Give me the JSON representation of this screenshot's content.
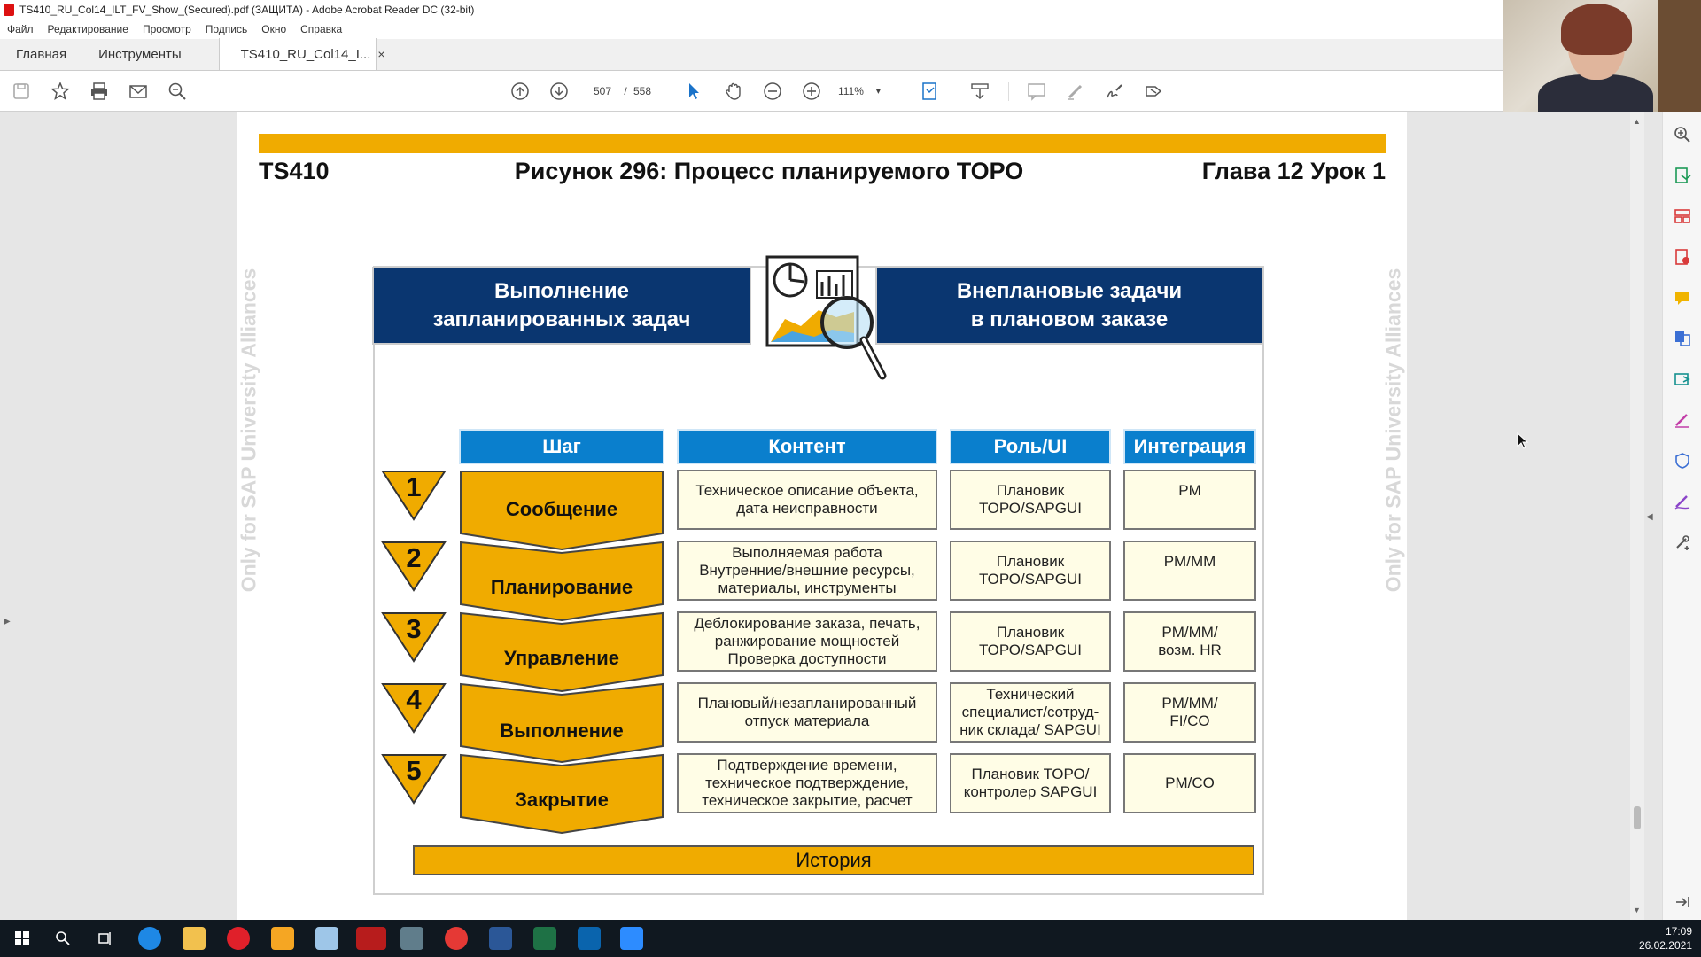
{
  "window": {
    "title": "TS410_RU_Col14_ILT_FV_Show_(Secured).pdf (ЗАЩИТА) - Adobe Acrobat Reader DC (32-bit)"
  },
  "menu": [
    "Файл",
    "Редактирование",
    "Просмотр",
    "Подпись",
    "Окно",
    "Справка"
  ],
  "tabs": {
    "home": "Главная",
    "tools": "Инструменты",
    "document": "TS410_RU_Col14_I...",
    "close_glyph": "×"
  },
  "toolbar": {
    "current_page": "507",
    "separator": "/",
    "total_pages": "558",
    "zoom": "111%",
    "zoom_chevron": "▾"
  },
  "slide": {
    "left_label": "TS410",
    "title": "Рисунок 296: Процесс планируемого ТОРО",
    "right_label": "Глава 12 Урок 1",
    "watermark": "Only for SAP University Alliances",
    "box_left": {
      "line1": "Выполнение",
      "line2": "запланированных задач"
    },
    "box_right": {
      "line1": "Внеплановые задачи",
      "line2": "в плановом заказе"
    },
    "headers": {
      "step": "Шаг",
      "content": "Контент",
      "role": "Роль/UI",
      "integration": "Интеграция"
    },
    "rows": [
      {
        "num": "1",
        "step": "Сообщение",
        "content": [
          "Техническое описание объекта,",
          "дата неисправности"
        ],
        "role": [
          "Плановик",
          "ТОРО/SAPGUI"
        ],
        "integration": [
          "PM"
        ]
      },
      {
        "num": "2",
        "step": "Планирование",
        "content": [
          "Выполняемая работа",
          "Внутренние/внешние ресурсы,",
          "материалы, инструменты"
        ],
        "role": [
          "Плановик",
          "ТОРО/SAPGUI"
        ],
        "integration": [
          "PM/MM"
        ]
      },
      {
        "num": "3",
        "step": "Управление",
        "content": [
          "Деблокирование заказа, печать,",
          "ранжирование мощностей",
          "Проверка доступности"
        ],
        "role": [
          "Плановик",
          "ТОРО/SAPGUI"
        ],
        "integration": [
          "PM/MM/",
          "возм. HR"
        ]
      },
      {
        "num": "4",
        "step": "Выполнение",
        "content": [
          "Плановый/незапланированный",
          "отпуск материала"
        ],
        "role": [
          "Технический",
          "специалист/сотруд-",
          "ник склада/ SAPGUI"
        ],
        "integration": [
          "PM/MM/",
          "FI/CO"
        ]
      },
      {
        "num": "5",
        "step": "Закрытие",
        "content": [
          "Подтверждение времени,",
          "техническое подтверждение,",
          "техническое закрытие, расчет"
        ],
        "role": [
          "Плановик ТОРО/",
          "контролер SAPGUI"
        ],
        "integration": [
          "PM/CO"
        ]
      }
    ],
    "history": "История"
  },
  "clock": {
    "time": "17:09",
    "date": "26.02.2021"
  },
  "colors": {
    "accent": "#f0ab00",
    "navy": "#0a3670",
    "header_blue": "#0a7fcd",
    "cell_bg": "#fffde6"
  }
}
